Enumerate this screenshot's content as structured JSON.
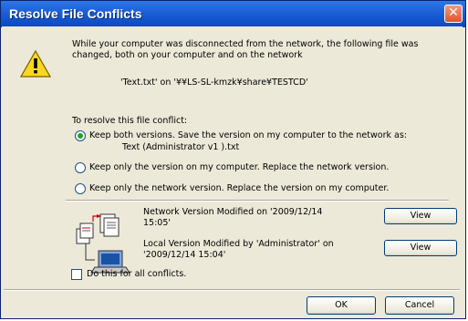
{
  "window": {
    "title": "Resolve File Conflicts",
    "close_glyph": "✕"
  },
  "message": {
    "text": "While your computer was disconnected from the network, the following file was changed, both on your computer and on the network",
    "file_line": "'Text.txt' on '¥¥LS-SL-kmzk¥share¥TESTCD'"
  },
  "resolve": {
    "label": "To resolve this file conflict:",
    "options": [
      {
        "label": "Keep both versions. Save the version on my computer to the network as:",
        "selected": true,
        "sublabel": "Text (Administrator v1 ).txt"
      },
      {
        "label": "Keep only the version on my computer. Replace the network version.",
        "selected": false
      },
      {
        "label": "Keep only the network version. Replace the version on my computer.",
        "selected": false
      }
    ]
  },
  "versions": {
    "network_text": "Network Version Modified on '2009/12/14 15:05'",
    "local_text": "Local Version Modified by 'Administrator' on '2009/12/14 15:04'",
    "view_label": "View"
  },
  "all_conflicts": {
    "label": "Do this for all conflicts.",
    "checked": false
  },
  "footer": {
    "ok_label": "OK",
    "cancel_label": "Cancel"
  },
  "icons": {
    "warning": "warning-icon",
    "network": "network-computers-icon"
  },
  "colors": {
    "titlebar": "#0a49c2",
    "close_button": "#d9562c",
    "dialog_bg": "#ece9d8",
    "radio_selected": "#21a121"
  }
}
